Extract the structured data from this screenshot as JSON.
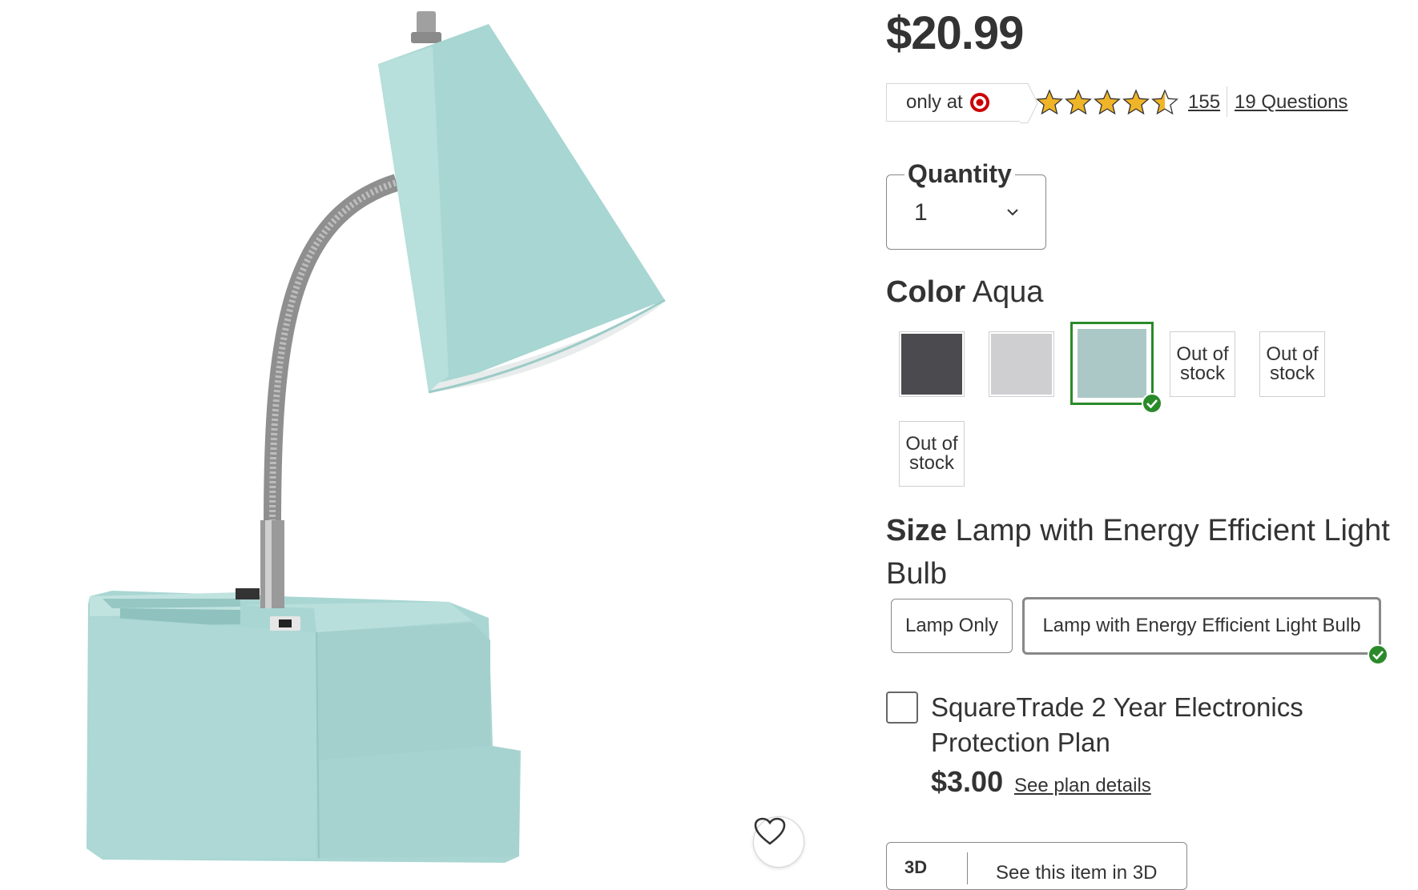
{
  "product": {
    "price": "$20.99",
    "only_at_label": "only at",
    "rating": {
      "value": 4.5,
      "max": 5
    },
    "review_count": "155",
    "questions_link": "19 Questions"
  },
  "quantity": {
    "label": "Quantity",
    "value": "1"
  },
  "color": {
    "label": "Color",
    "selected": "Aqua",
    "swatches": [
      {
        "color": "#4b4b4f",
        "state": "available"
      },
      {
        "color": "#cfcfd2",
        "state": "available"
      },
      {
        "color": "#acc8c6",
        "state": "selected"
      },
      {
        "state": "out_of_stock",
        "text": "Out of stock"
      },
      {
        "state": "out_of_stock",
        "text": "Out of stock"
      },
      {
        "state": "out_of_stock",
        "text": "Out of stock"
      }
    ]
  },
  "size": {
    "label": "Size",
    "selected": "Lamp with Energy Efficient Light Bulb",
    "options": [
      "Lamp Only",
      "Lamp with Energy Efficient Light Bulb"
    ]
  },
  "protection_plan": {
    "title": "SquareTrade 2 Year Electronics Protection Plan",
    "price": "$3.00",
    "details_link": "See plan details"
  },
  "view_3d": {
    "icon_text": "3D",
    "label": "See this item in 3D"
  },
  "colors": {
    "accent_check": "#2a8a2a",
    "target_red": "#cc0000",
    "star": "#f0b429"
  }
}
